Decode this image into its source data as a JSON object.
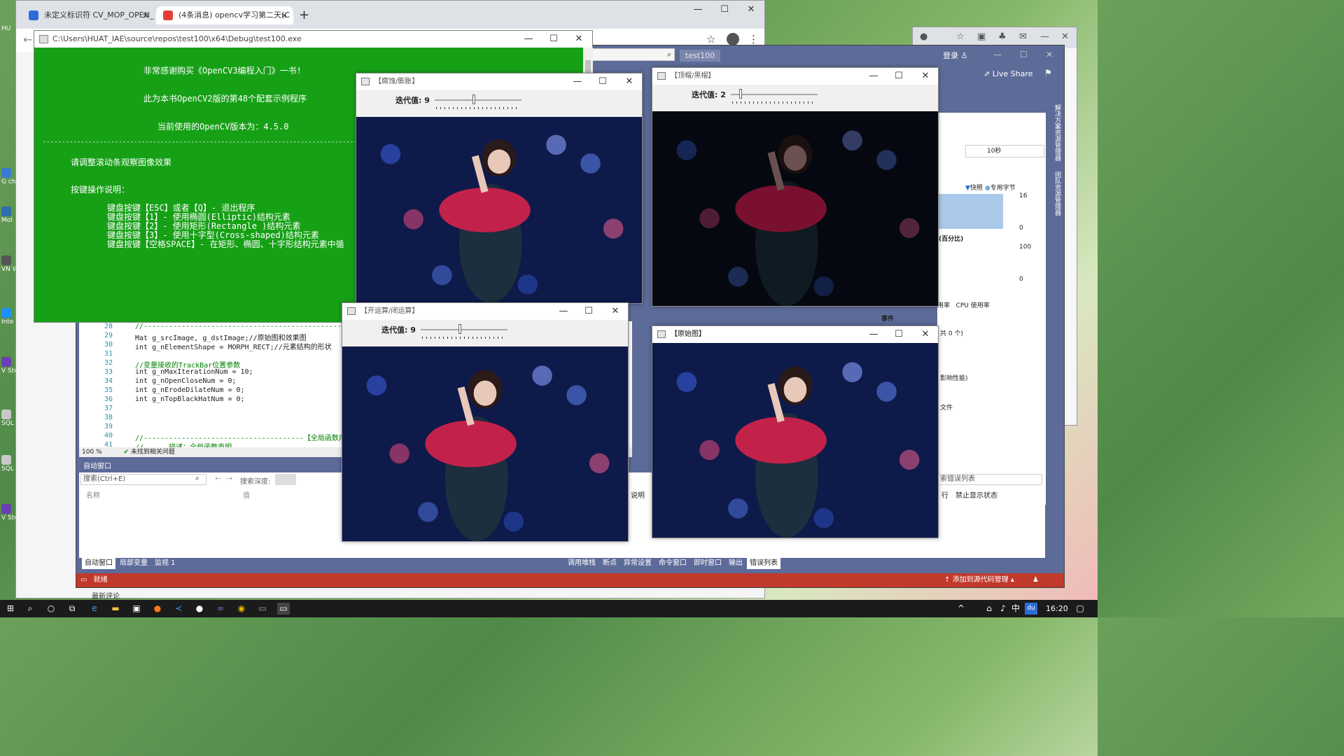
{
  "desktop": {
    "icons": [
      "HU",
      "G\nchi",
      "Mol",
      "VN\nWo",
      "Inte\nCon",
      "V\nStuc",
      "SQL\nMa",
      "SQL\nMa",
      "V\nStuc"
    ]
  },
  "browser": {
    "tabs": [
      {
        "label": "未定义标识符 CV_MOP_OPEN_",
        "close": "×"
      },
      {
        "label": "(4条消息) opencv学习第二天(C",
        "close": "×"
      }
    ],
    "new_tab": "+",
    "bottom_text": "最新评论"
  },
  "window_controls": {
    "minimize": "—",
    "maximize": "☐",
    "close": "✕"
  },
  "console": {
    "title": "C:\\Users\\HUAT_IAE\\source\\repos\\test100\\x64\\Debug\\test100.exe",
    "lines": {
      "thanks": "非常感谢购买《OpenCV3编程入门》一书!",
      "example": "此为本书OpenCV2版的第48个配套示例程序",
      "version": "当前使用的OpenCV版本为：4.5.0",
      "divider": "----------------------------------------------------------------------------------------------",
      "hint": "请调整滚动条观察图像效果",
      "keys_title": "按键操作说明：",
      "k1": "键盘按键【ESC】或者【Q】- 退出程序",
      "k2": "键盘按键【1】- 使用椭圆(Elliptic)结构元素",
      "k3": "键盘按键【2】- 使用矩形(Rectangle )结构元素",
      "k4": "键盘按键【3】- 使用十字型(Cross-shaped)结构元素",
      "k5": "键盘按键【空格SPACE】- 在矩形、椭圆、十字形结构元素中循"
    }
  },
  "vs": {
    "search_tab": "test100",
    "login": "登录",
    "live_share": "Live Share",
    "code_lines": [
      {
        "n": "28",
        "t": "//-----------------------------------------------------"
      },
      {
        "n": "29",
        "t": "Mat g_srcImage, g_dstImage;//原始图和效果图"
      },
      {
        "n": "30",
        "t": "int g_nElementShape = MORPH_RECT;//元素结构的形状"
      },
      {
        "n": "31",
        "t": ""
      },
      {
        "n": "32",
        "t": "//变量接收的TrackBar位置参数"
      },
      {
        "n": "33",
        "t": "int g_nMaxIterationNum = 10;"
      },
      {
        "n": "34",
        "t": "int g_nOpenCloseNum = 0;"
      },
      {
        "n": "35",
        "t": "int g_nErodeDilateNum = 0;"
      },
      {
        "n": "36",
        "t": "int g_nTopBlackHatNum = 0;"
      },
      {
        "n": "37",
        "t": ""
      },
      {
        "n": "38",
        "t": ""
      },
      {
        "n": "39",
        "t": ""
      },
      {
        "n": "40",
        "t": "//--------------------------------------【全局函数声明部"
      },
      {
        "n": "41",
        "t": "//      描述：全局函数声明"
      }
    ],
    "zoom": "100 %",
    "no_issues": "未找到相关问题",
    "auto_window": {
      "title": "自动窗口",
      "search_placeholder": "搜索(Ctrl+E)",
      "search_depth": "搜索深度:",
      "col_name": "名称",
      "col_value": "值"
    },
    "bottom_tabs_left": [
      "自动窗口",
      "局部变量",
      "监视 1"
    ],
    "bottom_tabs_right": [
      "调用堆栈",
      "断点",
      "异常设置",
      "命令窗口",
      "即时窗口",
      "输出",
      "错误列表"
    ],
    "status_ready": "就绪",
    "source_control": "添加到源代码管理",
    "diag": {
      "seconds": "10秒",
      "snapshot": "快照",
      "private_bytes": "专用字节",
      "mem_max": "16",
      "mem_min": "0",
      "cpu_title": "(百分比)",
      "cpu_max": "100",
      "cpu_min": "0",
      "tabs": "用率   CPU 使用率",
      "events": "事件",
      "count": "共 0 个)",
      "perf": "影响性能)",
      "file": "文件"
    },
    "error_list": {
      "search_placeholder": "索错误列表",
      "col_line": "行",
      "col_suppress": "禁止显示状态",
      "col_desc": "说明"
    },
    "side_tabs": [
      "解决方案资源管理器",
      "团队资源管理器"
    ]
  },
  "cv_windows": {
    "erode": {
      "title": "【腐蚀/膨胀】",
      "track_label": "迭代值: 9",
      "track_value": 9,
      "track_max": 20
    },
    "tophat": {
      "title": "【顶帽/黑帽】",
      "track_label": "迭代值: 2",
      "track_value": 2,
      "track_max": 20
    },
    "open": {
      "title": "【开运算/闭运算】",
      "track_label": "迭代值: 9",
      "track_value": 9,
      "track_max": 20
    },
    "orig": {
      "title": "【原始图】"
    }
  },
  "taskbar": {
    "time": "16:20",
    "ime": "中",
    "baidu": "du"
  },
  "colors": {
    "console_bg": "#16a016",
    "vs_chrome": "#5d6b99",
    "status_bar": "#c0392b"
  }
}
